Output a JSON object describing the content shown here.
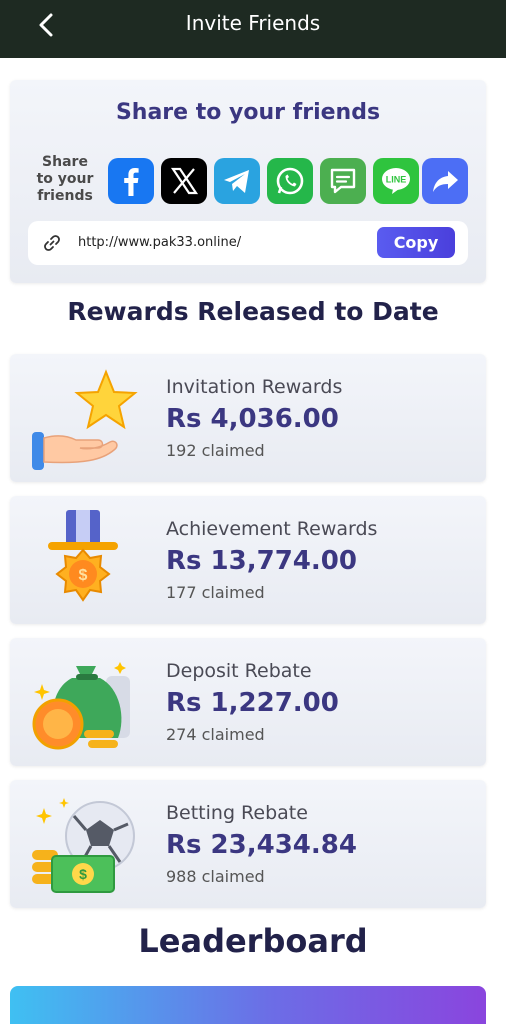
{
  "header": {
    "title": "Invite Friends"
  },
  "share": {
    "title": "Share to your friends",
    "label": "Share to your friends",
    "platforms": [
      {
        "name": "facebook-icon",
        "color": "#1877f2"
      },
      {
        "name": "x-icon",
        "color": "#000000"
      },
      {
        "name": "telegram-icon",
        "color": "#2aa3e0"
      },
      {
        "name": "whatsapp-icon",
        "color": "#25b74a"
      },
      {
        "name": "sms-icon",
        "color": "#4caf50"
      },
      {
        "name": "line-icon",
        "color": "#2fc43e"
      },
      {
        "name": "share-icon",
        "color": "#4c6ef5"
      }
    ],
    "link": "http://www.pak33.online/",
    "copy_label": "Copy"
  },
  "rewards_title": "Rewards Released to Date",
  "rewards": [
    {
      "name": "Invitation Rewards",
      "amount": "Rs  4,036.00",
      "claimed": "192 claimed",
      "icon": "star-hand-icon"
    },
    {
      "name": "Achievement Rewards",
      "amount": "Rs  13,774.00",
      "claimed": "177 claimed",
      "icon": "medal-icon"
    },
    {
      "name": "Deposit Rebate",
      "amount": "Rs  1,227.00",
      "claimed": "274 claimed",
      "icon": "money-bag-icon"
    },
    {
      "name": "Betting Rebate",
      "amount": "Rs  23,434.84",
      "claimed": "988 claimed",
      "icon": "football-cash-icon"
    }
  ],
  "leaderboard_title": "Leaderboard",
  "colors": {
    "topbar": "#1e2a22",
    "accent": "#3b3781",
    "copy_button": "#4a3fdc"
  }
}
